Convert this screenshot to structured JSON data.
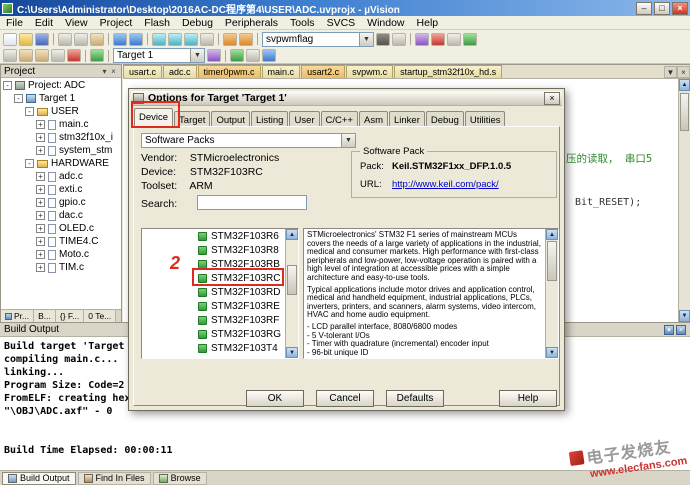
{
  "window": {
    "title": "C:\\Users\\Administrator\\Desktop\\2016AC-DC程序第4\\USER\\ADC.uvprojx - µVision"
  },
  "menubar": {
    "items": [
      "File",
      "Edit",
      "View",
      "Project",
      "Flash",
      "Debug",
      "Peripherals",
      "Tools",
      "SVCS",
      "Window",
      "Help"
    ]
  },
  "toolbar": {
    "find_value": "svpwmflag",
    "target_value": "Target 1"
  },
  "project": {
    "title": "Project",
    "tree": [
      "Project: ADC",
      "Target 1",
      "USER",
      "main.c",
      "stm32f10x_i",
      "system_stm",
      "HARDWARE",
      "adc.c",
      "exti.c",
      "gpio.c",
      "dac.c",
      "OLED.c",
      "TIME4.C",
      "Moto.c",
      "TIM.c"
    ],
    "tabs": [
      "Pr...",
      "B...",
      "{} F...",
      "0 Te..."
    ]
  },
  "editor": {
    "tabs": [
      "usart.c",
      "adc.c",
      "timer0pwm.c",
      "main.c",
      "usart2.c",
      "svpwm.c",
      "startup_stm32f10x_hd.s"
    ],
    "fragment1": "压的读取，  串口5",
    "fragment2": "Bit_RESET);"
  },
  "dialog": {
    "title": "Options for Target 'Target 1'",
    "tabs": [
      "Device",
      "Target",
      "Output",
      "Listing",
      "User",
      "C/C++",
      "Asm",
      "Linker",
      "Debug",
      "Utilities"
    ],
    "packs_combo": "Software Packs",
    "vendor_label": "Vendor:",
    "vendor_value": "STMicroelectronics",
    "device_label": "Device:",
    "device_value": "STM32F103RC",
    "toolset_label": "Toolset:",
    "toolset_value": "ARM",
    "search_label": "Search:",
    "group_label": "Software Pack",
    "pack_label": "Pack:",
    "pack_value": "Keil.STM32F1xx_DFP.1.0.5",
    "url_label": "URL:",
    "url_value": "http://www.keil.com/pack/",
    "devices": [
      "STM32F103R6",
      "STM32F103R8",
      "STM32F103RB",
      "STM32F103RC",
      "STM32F103RD",
      "STM32F103RE",
      "STM32F103RF",
      "STM32F103RG",
      "STM32F103T4"
    ],
    "desc_para1": "STMicroelectronics' STM32 F1 series of mainstream MCUs covers the needs of a large variety of applications in the industrial, medical and consumer markets. High performance with first-class peripherals and low-power, low-voltage operation is paired with a high level of integration at accessible prices with a simple architecture and easy-to-use tools.",
    "desc_para2": "Typical applications include motor drives and application control, medical and handheld equipment, industrial applications, PLCs, inverters, printers, and scanners, alarm systems, video intercom, HVAC and home audio equipment.",
    "desc_bullets": [
      "- LCD parallel interface, 8080/6800 modes",
      "- 5 V-tolerant I/Os",
      "- Timer with quadrature (incremental) encoder input",
      "- 96-bit unique ID"
    ],
    "btn_ok": "OK",
    "btn_cancel": "Cancel",
    "btn_defaults": "Defaults",
    "btn_help": "Help"
  },
  "build": {
    "title": "Build Output",
    "lines": [
      "Build target 'Target",
      "compiling main.c...",
      "linking...",
      "Program Size: Code=2",
      "FromELF: creating hex",
      "\"\\OBJ\\ADC.axf\" - 0",
      "Build Time Elapsed:  00:00:11"
    ]
  },
  "statusbar": {
    "tabs": [
      "Build Output",
      "Find In Files",
      "Browse"
    ]
  },
  "annotation": {
    "step": "2"
  },
  "watermark": {
    "brand": "电子发烧友",
    "site": "www.elecfans.com"
  }
}
